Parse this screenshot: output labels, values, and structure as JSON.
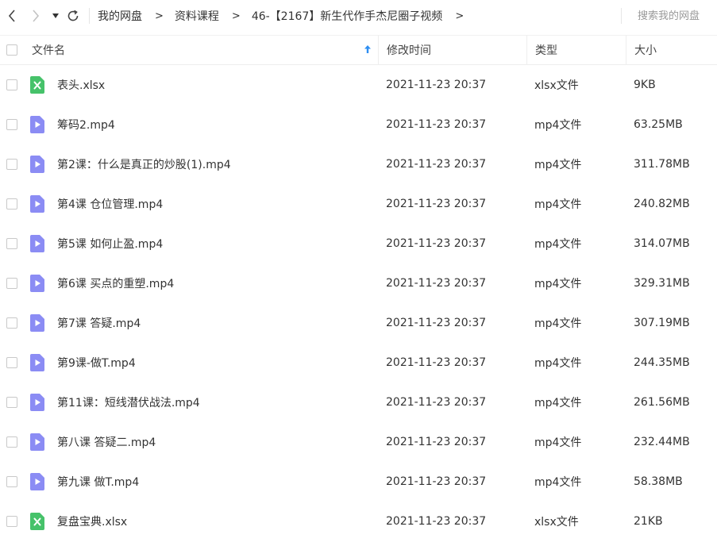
{
  "toolbar": {
    "back_icon": "chevron-left-icon",
    "forward_icon": "chevron-right-icon",
    "dropdown_icon": "triangle-down-icon",
    "refresh_icon": "refresh-icon",
    "breadcrumb": [
      "我的网盘",
      "资料课程",
      "46-【2167】新生代作手杰尼圈子视频"
    ],
    "breadcrumb_separator": ">",
    "search_placeholder": "搜索我的网盘"
  },
  "table": {
    "headers": {
      "name": "文件名",
      "time": "修改时间",
      "type": "类型",
      "size": "大小"
    },
    "sort": {
      "column": "name",
      "direction": "asc",
      "icon": "arrow-up-icon"
    },
    "rows": [
      {
        "name": "表头.xlsx",
        "time": "2021-11-23 20:37",
        "type": "xlsx文件",
        "size": "9KB",
        "icon": "excel-file-icon"
      },
      {
        "name": "筹码2.mp4",
        "time": "2021-11-23 20:37",
        "type": "mp4文件",
        "size": "63.25MB",
        "icon": "video-file-icon"
      },
      {
        "name": "第2课：什么是真正的炒股(1).mp4",
        "time": "2021-11-23 20:37",
        "type": "mp4文件",
        "size": "311.78MB",
        "icon": "video-file-icon"
      },
      {
        "name": "第4课 仓位管理.mp4",
        "time": "2021-11-23 20:37",
        "type": "mp4文件",
        "size": "240.82MB",
        "icon": "video-file-icon"
      },
      {
        "name": "第5课 如何止盈.mp4",
        "time": "2021-11-23 20:37",
        "type": "mp4文件",
        "size": "314.07MB",
        "icon": "video-file-icon"
      },
      {
        "name": "第6课 买点的重塑.mp4",
        "time": "2021-11-23 20:37",
        "type": "mp4文件",
        "size": "329.31MB",
        "icon": "video-file-icon"
      },
      {
        "name": "第7课 答疑.mp4",
        "time": "2021-11-23 20:37",
        "type": "mp4文件",
        "size": "307.19MB",
        "icon": "video-file-icon"
      },
      {
        "name": "第9课-做T.mp4",
        "time": "2021-11-23 20:37",
        "type": "mp4文件",
        "size": "244.35MB",
        "icon": "video-file-icon"
      },
      {
        "name": "第11课：短线潜伏战法.mp4",
        "time": "2021-11-23 20:37",
        "type": "mp4文件",
        "size": "261.56MB",
        "icon": "video-file-icon"
      },
      {
        "name": "第八课 答疑二.mp4",
        "time": "2021-11-23 20:37",
        "type": "mp4文件",
        "size": "232.44MB",
        "icon": "video-file-icon"
      },
      {
        "name": "第九课 做T.mp4",
        "time": "2021-11-23 20:37",
        "type": "mp4文件",
        "size": "58.38MB",
        "icon": "video-file-icon"
      },
      {
        "name": "复盘宝典.xlsx",
        "time": "2021-11-23 20:37",
        "type": "xlsx文件",
        "size": "21KB",
        "icon": "excel-file-icon"
      }
    ]
  },
  "colors": {
    "excel_icon": "#46c26a",
    "video_icon": "#8b8cf4",
    "sort_arrow": "#2e8ef2",
    "text": "#333333",
    "border": "#eeeeee"
  }
}
